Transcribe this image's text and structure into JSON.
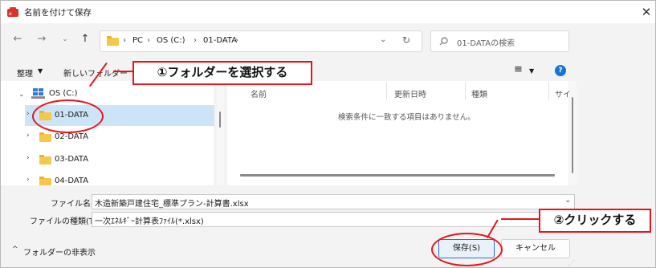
{
  "window": {
    "title": "名前を付けて保存"
  },
  "address": {
    "path": [
      "PC",
      "OS (C:)",
      "01-DATA"
    ]
  },
  "search": {
    "placeholder": "01-DATAの検索"
  },
  "toolbar": {
    "organize": "整理",
    "new_folder": "新しいフォルダー"
  },
  "tree": {
    "drive": "OS (C:)",
    "folders": [
      "01-DATA",
      "02-DATA",
      "03-DATA",
      "04-DATA"
    ]
  },
  "columns": {
    "name": "名前",
    "date": "更新日時",
    "type": "種類",
    "size": "サイ"
  },
  "empty_message": "検索条件に一致する項目はありません。",
  "filename": {
    "label": "ファイル名(N):",
    "value": "木造新築戸建住宅_標準プラン-計算書.xlsx"
  },
  "filetype": {
    "label": "ファイルの種類(T):",
    "value": "一次ｴﾈﾙｷﾞｰ計算表ﾌｧｲﾙ(*.xlsx)"
  },
  "footer": {
    "hide_folders": "フォルダーの非表示"
  },
  "buttons": {
    "save": "保存(S)",
    "cancel": "キャンセル"
  },
  "annotations": {
    "step1": "①フォルダーを選択する",
    "step2": "②クリックする",
    "color": "#e8141b"
  }
}
